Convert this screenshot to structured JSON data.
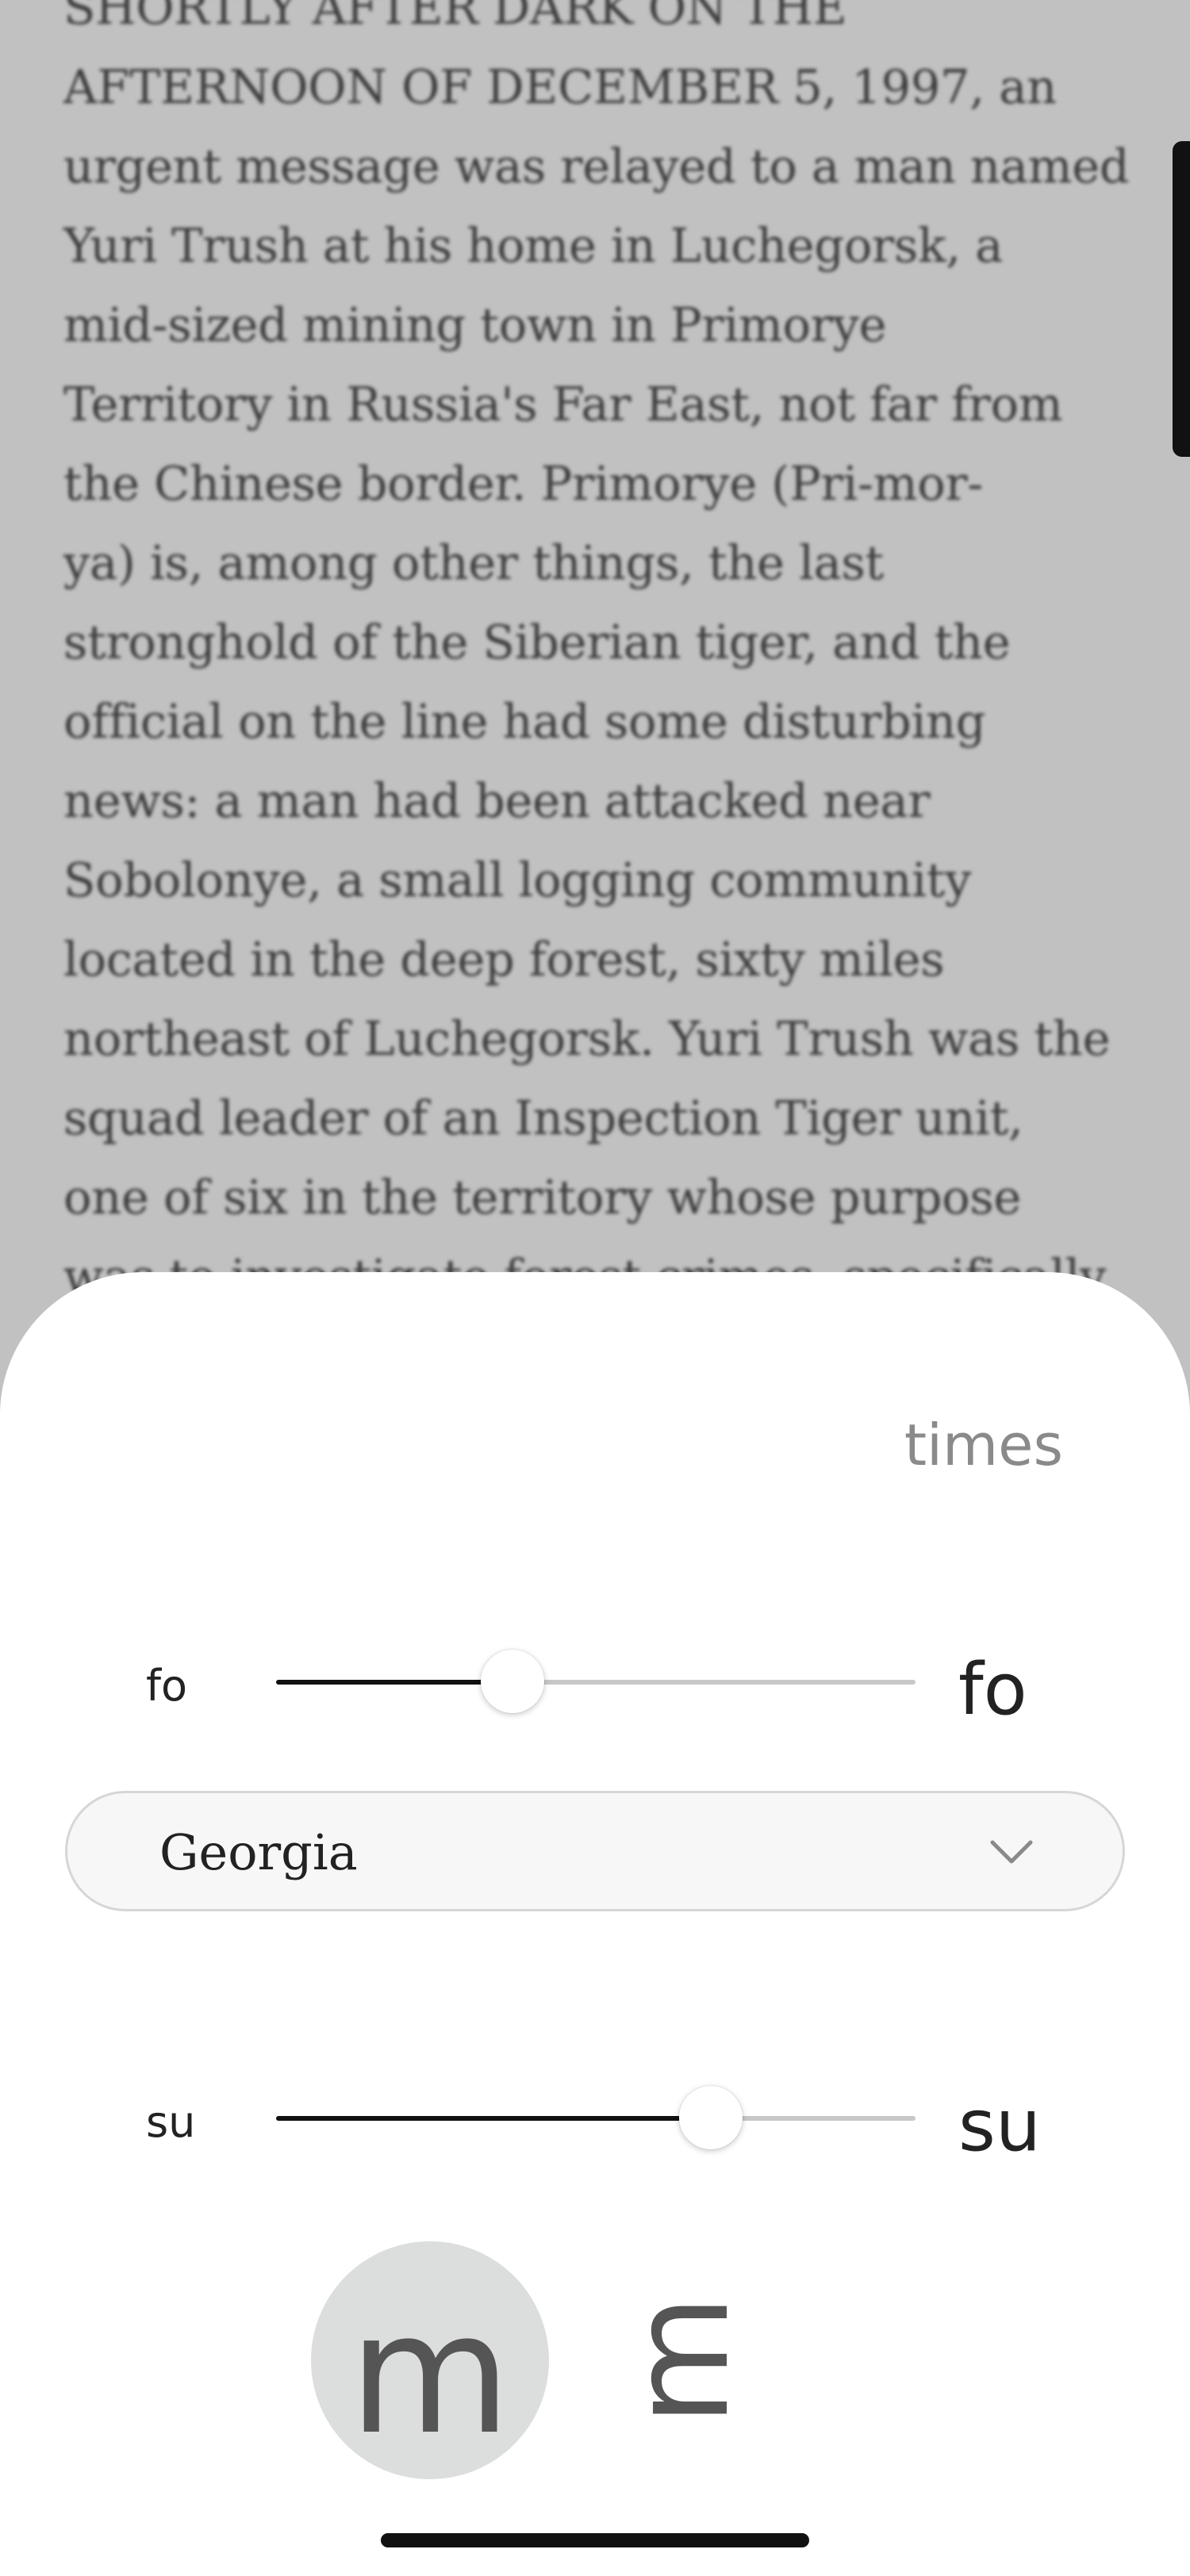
{
  "book": {
    "lines": [
      "SHORTLY AFTER DARK ON THE",
      "AFTERNOON OF DECEMBER 5, 1997, an",
      "urgent message was relayed to a man named",
      "Yuri Trush at his home in Luchegorsk, a",
      "mid-sized mining town in Primorye",
      "Territory in Russia's Far East, not far from",
      "the Chinese border. Primorye (Pri-mor-",
      "ya) is, among other things, the last",
      "stronghold of the Siberian tiger, and the",
      "official on the line had some disturbing",
      "news: a man had been attacked near",
      "Sobolonye, a small logging community",
      "located in the deep forest, sixty miles",
      "northeast of Luchegorsk. Yuri Trush was the",
      "squad leader of an Inspection Tiger unit,",
      "one of six in the territory whose purpose",
      "was to investigate forest crimes, specifically"
    ]
  },
  "sheet": {
    "done_label": "times",
    "font_size": {
      "small_label": "fo",
      "large_label": "fo",
      "level": 0.37
    },
    "font_family": {
      "selected": "Georgia",
      "chevron_icon": "chevron-down-icon"
    },
    "spacing": {
      "small_label": "su",
      "large_label": "su",
      "level": 0.68
    },
    "modes": [
      {
        "glyph": "m",
        "selected": true
      },
      {
        "glyph": "m",
        "selected": false
      }
    ]
  }
}
